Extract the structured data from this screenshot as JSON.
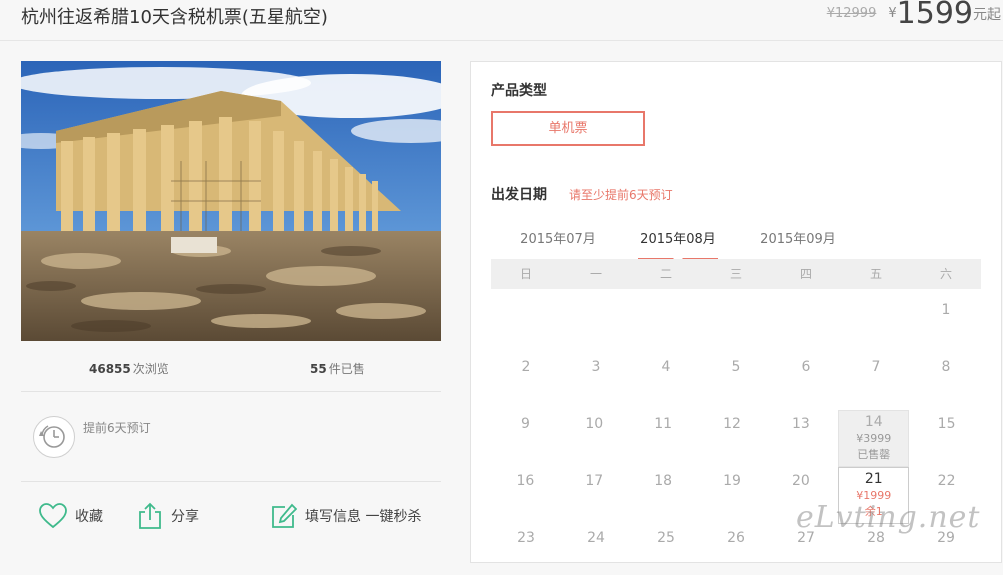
{
  "product": {
    "title": "杭州往返希腊10天含税机票(五星航空)",
    "original_price": "¥12999",
    "currency": "¥",
    "price": "1599",
    "price_suffix": "元起"
  },
  "stats": {
    "views_count": "46855",
    "views_label": "次浏览",
    "sold_count": "55",
    "sold_label": "件已售"
  },
  "advance_booking": {
    "text": "提前6天预订"
  },
  "actions": {
    "favorite": "收藏",
    "share": "分享",
    "fill_info": "填写信息 一键秒杀"
  },
  "booking": {
    "type_label": "产品类型",
    "type_option": "单机票",
    "date_label": "出发日期",
    "notice": "请至少提前6天预订",
    "months": [
      "2015年07月",
      "2015年08月",
      "2015年09月"
    ],
    "active_month_index": 1,
    "weekdays": [
      "日",
      "一",
      "二",
      "三",
      "四",
      "五",
      "六"
    ],
    "weeks": [
      [
        "",
        "",
        "",
        "",
        "",
        "",
        "1"
      ],
      [
        "2",
        "3",
        "4",
        "5",
        "6",
        "7",
        "8"
      ],
      [
        "9",
        "10",
        "11",
        "12",
        "13",
        "14",
        "15"
      ],
      [
        "16",
        "17",
        "18",
        "19",
        "20",
        "21",
        "22"
      ],
      [
        "23",
        "24",
        "25",
        "26",
        "27",
        "28",
        "29"
      ]
    ],
    "special_days": {
      "14": {
        "price": "¥3999",
        "status": "已售罄",
        "state": "soldout"
      },
      "21": {
        "price": "¥1999",
        "status": "余1",
        "state": "available"
      }
    }
  },
  "colors": {
    "accent": "#e8776a",
    "action_green": "#3fba8c"
  },
  "watermark": "eLvting.net"
}
